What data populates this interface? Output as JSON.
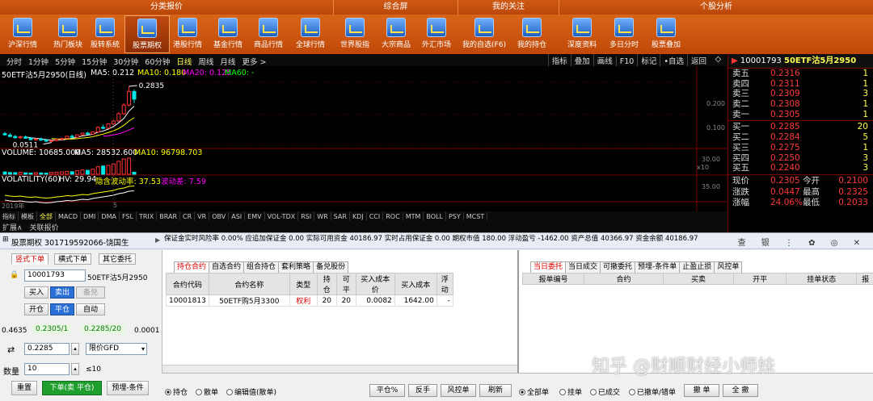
{
  "toolbar": {
    "groups": [
      {
        "label": "分类报价"
      },
      {
        "label": "综合屏"
      },
      {
        "label": "我的关注"
      },
      {
        "label": "个股分析"
      }
    ],
    "buttons": [
      {
        "label": "沪深行情",
        "icon": "market-icon"
      },
      {
        "label": "热门板块",
        "icon": "hot-sector-icon"
      },
      {
        "label": "股转系统",
        "icon": "transfer-system-icon"
      },
      {
        "label": "股票期权",
        "icon": "stock-option-icon"
      },
      {
        "label": "港股行情",
        "icon": "hk-market-icon"
      },
      {
        "label": "基金行情",
        "icon": "fund-icon"
      },
      {
        "label": "商品行情",
        "icon": "commodity-icon"
      },
      {
        "label": "全球行情",
        "icon": "globe-icon"
      },
      {
        "label": "世界股指",
        "icon": "world-index-icon"
      },
      {
        "label": "大宗商品",
        "icon": "bulk-commodity-icon"
      },
      {
        "label": "外汇市场",
        "icon": "forex-icon"
      },
      {
        "label": "我的自选(F6)",
        "icon": "watchlist-icon"
      },
      {
        "label": "我的持仓",
        "icon": "holdings-icon"
      },
      {
        "label": "深度资料",
        "icon": "deep-data-icon"
      },
      {
        "label": "多日分时",
        "icon": "calendar-icon"
      },
      {
        "label": "股票叠加",
        "icon": "overlay-icon"
      }
    ]
  },
  "periods": [
    "分时",
    "1分钟",
    "5分钟",
    "15分钟",
    "30分钟",
    "60分钟",
    "日线",
    "周线",
    "月线",
    "更多 >"
  ],
  "period_active": "日线",
  "chart_tools": [
    "指标",
    "叠加",
    "画线",
    "F10",
    "标记",
    "•自选",
    "返回"
  ],
  "chart": {
    "title_line": "50ETF沽5月2950(日线)",
    "ma5": "MA5: 0.212",
    "ma10": "MA10: 0.180",
    "ma20": "MA20: 0.125",
    "ma60": "MA60: -",
    "high_label": "0.2835",
    "low_label": "0.0511",
    "yaxis_price": [
      "0.200",
      "0.100"
    ],
    "volume_line": "VOLUME: 10685.000",
    "volume_ma5": "MA5: 28532.600",
    "volume_ma10": "MA10: 96798.703",
    "vol_axis": [
      "30.00",
      "x10"
    ],
    "vol_line": "VOLATILITY(60)",
    "hv": "HV: 29.94",
    "implied": "隐含波动率: 37.53",
    "wave": "波动差: 7.59",
    "vol_axis2": [
      "35.00"
    ],
    "year_label": "2019年",
    "month_label": "5",
    "colors": {
      "up": "#ff3333",
      "down": "#00e5e5",
      "ma5": "#ffffff",
      "ma10": "#ffff00",
      "ma20": "#ff00ff"
    }
  },
  "chart_data": {
    "type": "candlestick",
    "ohlc": [
      {
        "o": 0.088,
        "h": 0.095,
        "l": 0.08,
        "c": 0.083
      },
      {
        "o": 0.082,
        "h": 0.09,
        "l": 0.074,
        "c": 0.076
      },
      {
        "o": 0.076,
        "h": 0.083,
        "l": 0.068,
        "c": 0.071
      },
      {
        "o": 0.071,
        "h": 0.079,
        "l": 0.066,
        "c": 0.075
      },
      {
        "o": 0.074,
        "h": 0.08,
        "l": 0.067,
        "c": 0.069
      },
      {
        "o": 0.069,
        "h": 0.074,
        "l": 0.06,
        "c": 0.063
      },
      {
        "o": 0.063,
        "h": 0.07,
        "l": 0.058,
        "c": 0.066
      },
      {
        "o": 0.066,
        "h": 0.072,
        "l": 0.059,
        "c": 0.061
      },
      {
        "o": 0.061,
        "h": 0.066,
        "l": 0.054,
        "c": 0.057
      },
      {
        "o": 0.057,
        "h": 0.062,
        "l": 0.0511,
        "c": 0.059
      },
      {
        "o": 0.059,
        "h": 0.066,
        "l": 0.056,
        "c": 0.064
      },
      {
        "o": 0.064,
        "h": 0.071,
        "l": 0.061,
        "c": 0.068
      },
      {
        "o": 0.068,
        "h": 0.079,
        "l": 0.066,
        "c": 0.077
      },
      {
        "o": 0.077,
        "h": 0.084,
        "l": 0.071,
        "c": 0.073
      },
      {
        "o": 0.073,
        "h": 0.085,
        "l": 0.071,
        "c": 0.083
      },
      {
        "o": 0.083,
        "h": 0.093,
        "l": 0.079,
        "c": 0.09
      },
      {
        "o": 0.09,
        "h": 0.096,
        "l": 0.083,
        "c": 0.086
      },
      {
        "o": 0.086,
        "h": 0.097,
        "l": 0.084,
        "c": 0.095
      },
      {
        "o": 0.095,
        "h": 0.118,
        "l": 0.092,
        "c": 0.114
      },
      {
        "o": 0.114,
        "h": 0.125,
        "l": 0.106,
        "c": 0.11
      },
      {
        "o": 0.11,
        "h": 0.131,
        "l": 0.108,
        "c": 0.128
      },
      {
        "o": 0.128,
        "h": 0.145,
        "l": 0.122,
        "c": 0.14
      },
      {
        "o": 0.14,
        "h": 0.176,
        "l": 0.136,
        "c": 0.17
      },
      {
        "o": 0.17,
        "h": 0.214,
        "l": 0.165,
        "c": 0.206
      },
      {
        "o": 0.206,
        "h": 0.2835,
        "l": 0.2,
        "c": 0.262
      },
      {
        "o": 0.262,
        "h": 0.27,
        "l": 0.214,
        "c": 0.2305
      }
    ],
    "volume": [
      12000,
      9000,
      8500,
      10000,
      7500,
      6200,
      8800,
      7000,
      5800,
      9500,
      11000,
      12500,
      15000,
      13000,
      18000,
      22000,
      20000,
      26000,
      38000,
      42000,
      45000,
      52000,
      66000,
      78000,
      82000,
      10685
    ],
    "volatility": [
      26,
      25,
      24.5,
      25,
      24,
      23.5,
      24,
      23,
      22.5,
      23,
      24,
      24.5,
      25.5,
      25,
      26,
      27,
      26.5,
      28,
      29,
      30,
      31,
      32,
      34,
      35,
      37,
      37.53
    ],
    "price_range": [
      0.04,
      0.3
    ],
    "xlabel": "",
    "ylabel": ""
  },
  "indicators": [
    "指标",
    "模板",
    "全部",
    "MACD",
    "DMI",
    "DMA",
    "FSL",
    "TRIX",
    "BRAR",
    "CR",
    "VR",
    "OBV",
    "ASI",
    "EMV",
    "VOL-TDX",
    "RSI",
    "WR",
    "SAR",
    "KDJ",
    "CCI",
    "ROC",
    "MTM",
    "BOLL",
    "PSY",
    "MCST"
  ],
  "indicators_active": "全部",
  "extension_tabs": [
    "扩展∧",
    "关联报价"
  ],
  "quote": {
    "code": "10001793",
    "name": "50ETF沽5月2950",
    "asks": [
      {
        "label": "卖五",
        "price": "0.2316",
        "vol": "1"
      },
      {
        "label": "卖四",
        "price": "0.2311",
        "vol": "1"
      },
      {
        "label": "卖三",
        "price": "0.2309",
        "vol": "3"
      },
      {
        "label": "卖二",
        "price": "0.2308",
        "vol": "1"
      },
      {
        "label": "卖一",
        "price": "0.2305",
        "vol": "1"
      }
    ],
    "bids": [
      {
        "label": "买一",
        "price": "0.2285",
        "vol": "20"
      },
      {
        "label": "买二",
        "price": "0.2284",
        "vol": "5"
      },
      {
        "label": "买三",
        "price": "0.2275",
        "vol": "1"
      },
      {
        "label": "买四",
        "price": "0.2250",
        "vol": "3"
      },
      {
        "label": "买五",
        "price": "0.2240",
        "vol": "3"
      }
    ],
    "stats": [
      {
        "l1": "现价",
        "v1": "0.2305",
        "l2": "今开",
        "v2": "0.2100"
      },
      {
        "l1": "涨跌",
        "v1": "0.0447",
        "l2": "最高",
        "v2": "0.2325"
      },
      {
        "l1": "涨幅",
        "v1": "24.06%",
        "l2": "最低",
        "v2": "0.2033"
      }
    ]
  },
  "bottom": {
    "panel_title": "股票期权 301719592066-饶国生",
    "account_line": "保证金实时风险率 0.00% 应追加保证金 0.00 实际可用资金 40186.97 实时占用保证金 0.00 期权市值 180.00 浮动盈亏 -1462.00 资产总值 40366.97 资金余额 40186.97",
    "top_icons": "查 银 ⋮ ✿ ◎ ✕",
    "order_tabs": [
      "竖式下单",
      "横式下单",
      "其它委托"
    ],
    "order_tab_active": "竖式下单",
    "contract_code": "10001793",
    "contract_name": "50ETF沽5月2950",
    "dir_buttons": [
      "买入",
      "卖出",
      "备兑"
    ],
    "open_buttons": [
      "开仓",
      "平仓",
      "自动"
    ],
    "quote_line": [
      "0.4635",
      "0.2305/1",
      "0.2285/20",
      "0.0001"
    ],
    "price_label": "价格",
    "price_value": "0.2285",
    "price_type": "限价GFD",
    "qty_label": "数量",
    "qty_value": "10",
    "qty_max": "≤10",
    "reset": "重置",
    "submit": "下单(卖 平仓)",
    "preorder": "预埋-条件"
  },
  "positions": {
    "tabs": [
      "持仓合约",
      "自选合约",
      "组合持仓",
      "套利策略",
      "备兑股份"
    ],
    "tab_active": "持仓合约",
    "headers": [
      "合约代码",
      "合约名称",
      "类型",
      "持仓",
      "可平",
      "买入成本价",
      "买入成本",
      "浮动"
    ],
    "rows": [
      [
        "10001813",
        "50ETF购5月3300",
        "权利",
        "20",
        "20",
        "0.0082",
        "1642.00",
        "-"
      ]
    ]
  },
  "orders": {
    "tabs": [
      "当日委托",
      "当日成交",
      "可撤委托",
      "预埋-条件单",
      "止盈止损",
      "风控单"
    ],
    "tab_active": "当日委托",
    "headers": [
      "报单编号",
      "合约",
      "买卖",
      "开平",
      "挂单状态",
      "报"
    ]
  },
  "bottom_bar": {
    "left_radios": [
      "持仓",
      "散单",
      "编辑值(散单)"
    ],
    "left_radio_active": "持仓",
    "buttons": [
      "平仓%",
      "反手",
      "风控单",
      "刷新"
    ],
    "right_radios": [
      "全部单",
      "挂单",
      "已成交",
      "已撤单/错单"
    ],
    "right_radio_active": "全部单",
    "right_buttons": [
      "撤 单",
      "全 撤"
    ]
  },
  "watermark": "知乎 @财顺财经小师妹"
}
